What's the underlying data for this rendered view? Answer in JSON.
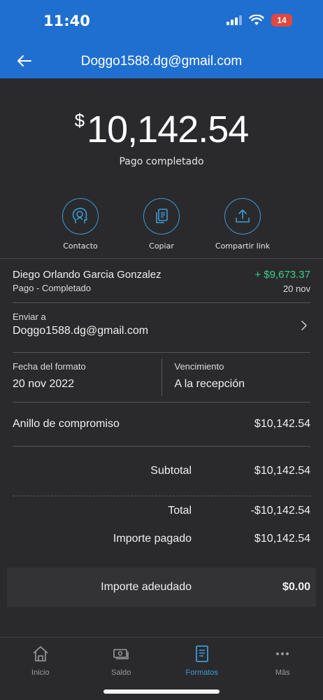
{
  "status_bar": {
    "time": "11:40",
    "battery": "14"
  },
  "header": {
    "title": "Doggo1588.dg@gmail.com"
  },
  "summary": {
    "currency_symbol": "$",
    "amount": "10,142.54",
    "status": "Pago completado"
  },
  "actions": [
    {
      "label": "Contacto",
      "icon": "contact-icon"
    },
    {
      "label": "Copiar",
      "icon": "copy-icon"
    },
    {
      "label": "Compartir link",
      "icon": "share-icon"
    }
  ],
  "transaction": {
    "name": "Diego Orlando Garcia Gonzalez",
    "subtitle": "Pago - Completado",
    "amount": "+ $9,673.37",
    "date": "20 nov"
  },
  "send_to": {
    "label": "Enviar a",
    "value": "Doggo1588.dg@gmail.com"
  },
  "dates": {
    "issue_label": "Fecha del formato",
    "issue_value": "20 nov 2022",
    "due_label": "Vencimiento",
    "due_value": "A la recepción"
  },
  "line_item": {
    "name": "Anillo de compromiso",
    "amount": "$10,142.54"
  },
  "totals": {
    "subtotal_label": "Subtotal",
    "subtotal_value": "$10,142.54",
    "total_label": "Total",
    "total_value": "-$10,142.54",
    "paid_label": "Importe pagado",
    "paid_value": "$10,142.54",
    "owed_label": "Importe adeudado",
    "owed_value": "$0.00"
  },
  "bottom_nav": [
    {
      "label": "Inicio",
      "icon": "home-icon"
    },
    {
      "label": "Saldo",
      "icon": "wallet-icon"
    },
    {
      "label": "Formatos",
      "icon": "document-icon",
      "active": true
    },
    {
      "label": "Más",
      "icon": "more-icon"
    }
  ],
  "colors": {
    "header_blue": "#1f6fd0",
    "accent_blue": "#3b9bd9",
    "positive_green": "#3ccf8a",
    "background": "#2a2a2c"
  }
}
